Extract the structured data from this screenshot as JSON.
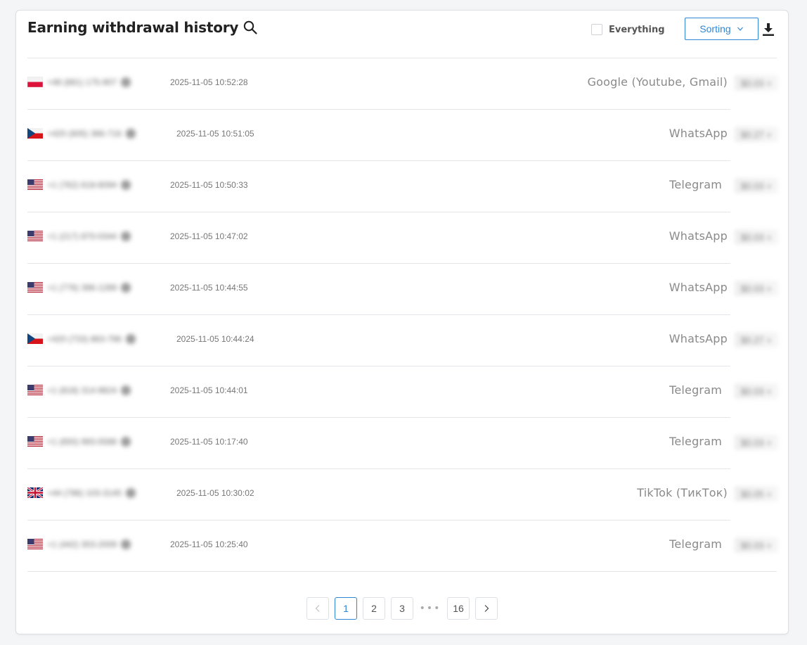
{
  "header": {
    "title": "Earning withdrawal history",
    "everything_label": "Everything",
    "sorting_label": "Sorting"
  },
  "rows": [
    {
      "flag": "PL",
      "phone": "+48 (861) 175-907",
      "time": "2025-11-05 10:52:28",
      "service": "Google (Youtube, Gmail)",
      "amount": "$0.03 +"
    },
    {
      "flag": "CZ",
      "phone": "+420 (605) 366-716",
      "time": "2025-11-05 10:51:05",
      "service": "WhatsApp",
      "amount": "$0.27 +"
    },
    {
      "flag": "US",
      "phone": "+1 (762) 618-6094",
      "time": "2025-11-05 10:50:33",
      "service": "Telegram",
      "amount": "$0.03 +"
    },
    {
      "flag": "US",
      "phone": "+1 (217) 870-0344",
      "time": "2025-11-05 10:47:02",
      "service": "WhatsApp",
      "amount": "$0.03 +"
    },
    {
      "flag": "US",
      "phone": "+1 (776) 396-1289",
      "time": "2025-11-05 10:44:55",
      "service": "WhatsApp",
      "amount": "$0.03 +"
    },
    {
      "flag": "CZ",
      "phone": "+420 (733) 863-796",
      "time": "2025-11-05 10:44:24",
      "service": "WhatsApp",
      "amount": "$0.27 +"
    },
    {
      "flag": "US",
      "phone": "+1 (818) 314-9824",
      "time": "2025-11-05 10:44:01",
      "service": "Telegram",
      "amount": "$0.03 +"
    },
    {
      "flag": "US",
      "phone": "+1 (650) 993-5588",
      "time": "2025-11-05 10:17:40",
      "service": "Telegram",
      "amount": "$0.03 +"
    },
    {
      "flag": "GB",
      "phone": "+44 (786) 103-3145",
      "time": "2025-11-05 10:30:02",
      "service": "TikTok (ТикТок)",
      "amount": "$0.05 +"
    },
    {
      "flag": "US",
      "phone": "+1 (442) 303-2009",
      "time": "2025-11-05 10:25:40",
      "service": "Telegram",
      "amount": "$0.03 +"
    }
  ],
  "pagination": {
    "pages": [
      "1",
      "2",
      "3"
    ],
    "ellipsis": "•••",
    "last": "16",
    "current": "1"
  },
  "colors": {
    "accent": "#2f86d4",
    "text": "#222222",
    "muted": "#8a8a8a",
    "border": "#e3e5e8"
  }
}
